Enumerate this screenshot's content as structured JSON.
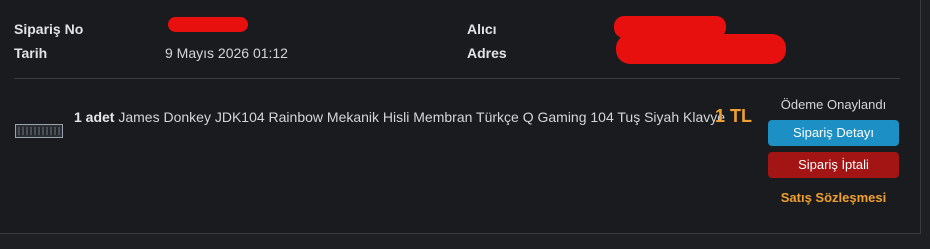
{
  "order": {
    "number_label": "Sipariş No",
    "date_label": "Tarih",
    "date_value": "9 Mayıs 2026 01:12",
    "recipient_label": "Alıcı",
    "address_label": "Adres"
  },
  "item": {
    "quantity": "1 adet",
    "title": "James Donkey JDK104 Rainbow Mekanik Hisli Membran Türkçe Q Gaming 104 Tuş Siyah Klavye",
    "price": "1 TL",
    "thumbnail_icon": "keyboard-icon"
  },
  "actions": {
    "status": "Ödeme Onaylandı",
    "detail_button": "Sipariş Detayı",
    "cancel_button": "Sipariş İptali",
    "contract_link": "Satış Sözleşmesi"
  },
  "colors": {
    "background": "#1a1b1e",
    "accent_price": "#f0a030",
    "detail_button": "#1c8fc4",
    "cancel_button": "#a31515",
    "redaction": "#e8100e"
  }
}
